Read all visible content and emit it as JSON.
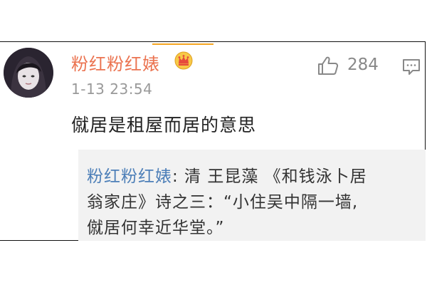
{
  "comment": {
    "username": "粉红粉红婊",
    "badge_icon": "crown-icon",
    "timestamp": "1-13 23:54",
    "like_icon": "thumbs-up-icon",
    "like_count": "284",
    "reply_icon": "comment-icon",
    "text": "僦居是租屋而居的意思"
  },
  "quote": {
    "author": "粉红粉红婊",
    "line1_text": ": 清 王昆藻 《和钱泳卜居",
    "line2": "翁家庄》诗之三：“小住吴中隔一墙,",
    "line3": "僦居何幸近华堂。”"
  },
  "colors": {
    "username": "#eb7350",
    "link": "#4d7fb8",
    "quote_bg": "#f2f2f2",
    "meta": "#999999",
    "accent": "#f5a623"
  }
}
